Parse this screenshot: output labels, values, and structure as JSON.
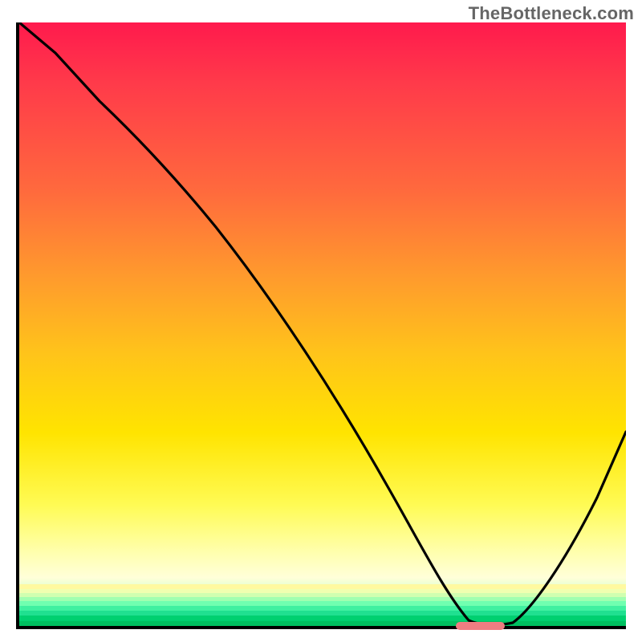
{
  "watermark": "TheBottleneck.com",
  "chart_data": {
    "type": "line",
    "title": "",
    "xlabel": "",
    "ylabel": "",
    "xlim": [
      0,
      100
    ],
    "ylim": [
      0,
      100
    ],
    "x": [
      0,
      5,
      12,
      20,
      28,
      36,
      44,
      52,
      60,
      66,
      70,
      74,
      78,
      84,
      92,
      100
    ],
    "values": [
      100,
      95,
      88,
      80,
      71,
      60,
      49,
      38,
      26,
      15,
      6,
      1,
      0,
      7,
      22,
      42
    ],
    "annotations": [
      {
        "kind": "marker",
        "x_start": 72,
        "x_end": 80,
        "y": 0,
        "color": "#ef7d82"
      }
    ],
    "grid": false,
    "legend": false
  },
  "colors": {
    "axis": "#000000",
    "curve": "#000000",
    "marker": "#ef7d82",
    "watermark": "#666666"
  }
}
